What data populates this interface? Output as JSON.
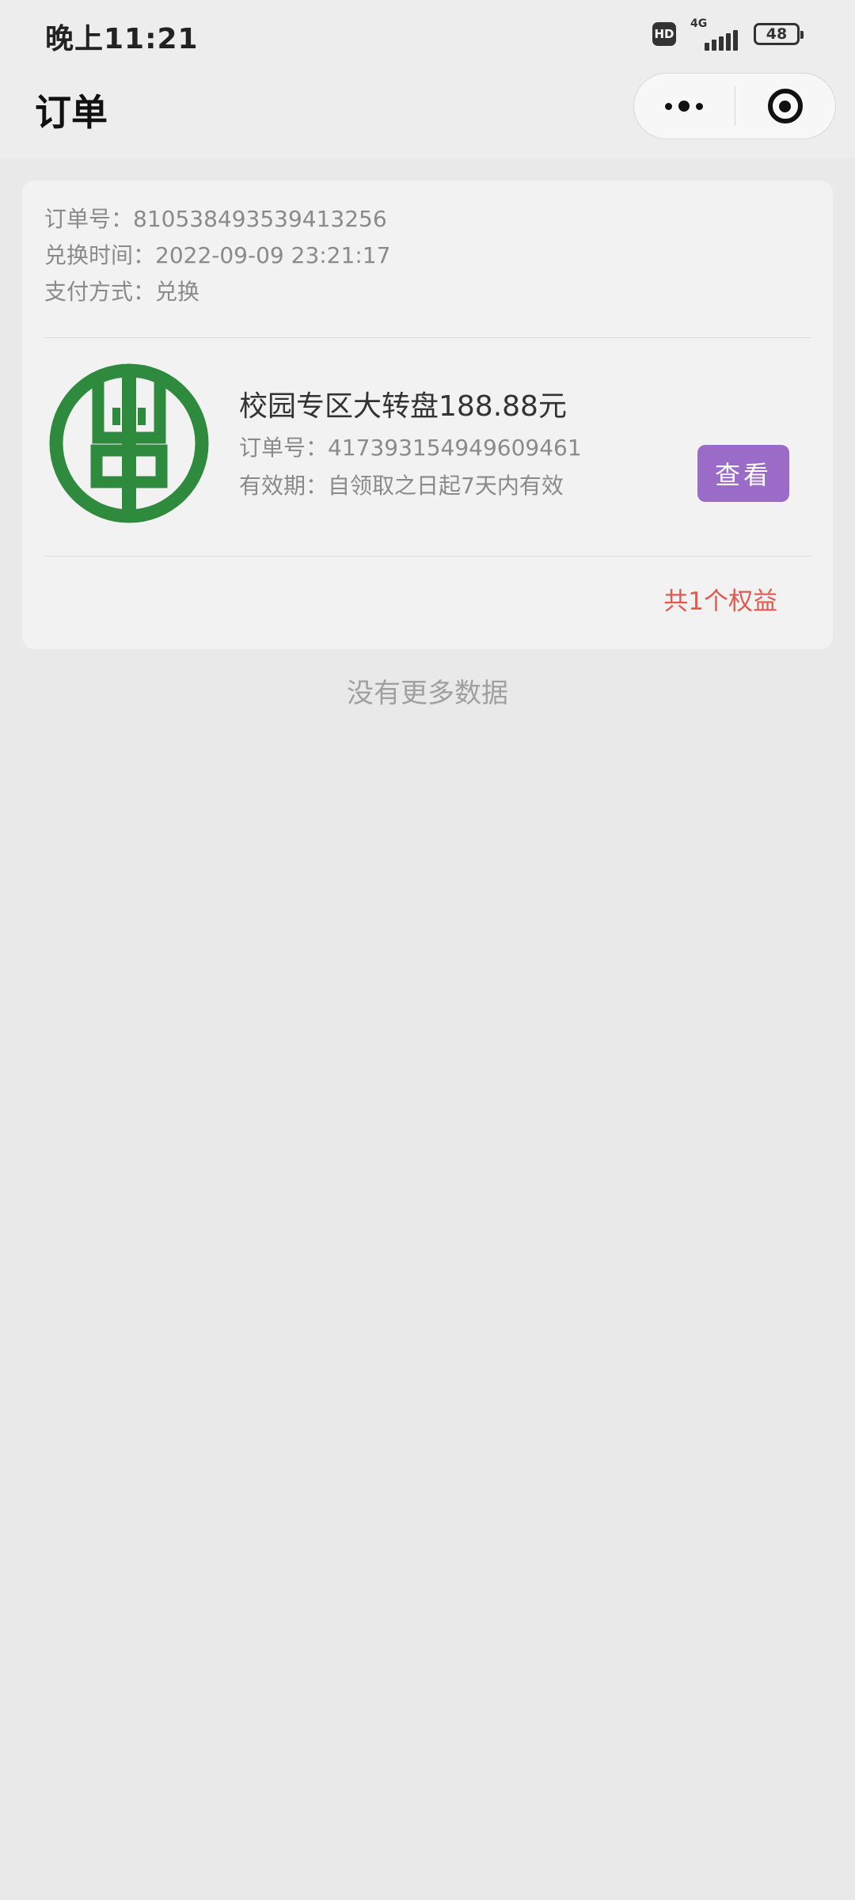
{
  "status_bar": {
    "time": "晚上11:21",
    "hd": "HD",
    "network": "4G",
    "battery": "48"
  },
  "nav": {
    "title": "订单"
  },
  "order": {
    "order_no": "订单号：810538493539413256",
    "exchange_time": "兑换时间：2022-09-09 23:21:17",
    "payment_method": "支付方式：兑换",
    "item": {
      "title": "校园专区大转盘188.88元",
      "item_order_no": "订单号：417393154949609461",
      "validity": "有效期：自领取之日起7天内有效",
      "view_button": "查看"
    },
    "benefit_count": "共1个权益"
  },
  "footer": {
    "no_more": "没有更多数据"
  },
  "colors": {
    "accent_button": "#9b6bc8",
    "benefit_text": "#e05a4f",
    "logo_green": "#2e8b3e"
  }
}
